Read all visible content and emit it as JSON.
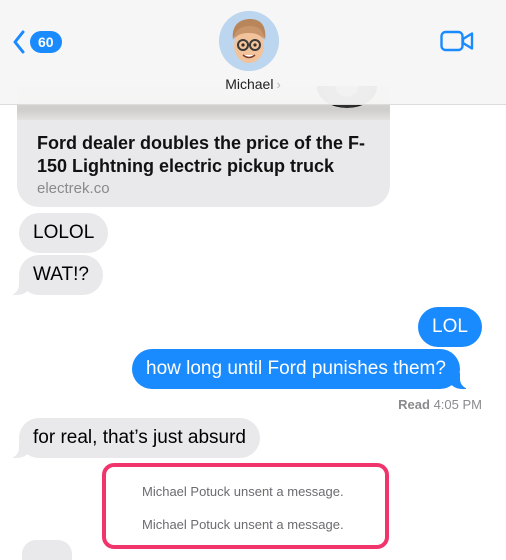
{
  "header": {
    "back_badge": "60",
    "contact_name": "Michael",
    "contact_chevron": "›",
    "icons": {
      "back": "chevron-left-icon",
      "avatar": "memoji-avatar",
      "video": "facetime-video-icon"
    }
  },
  "link_preview": {
    "title": "Ford dealer doubles the price of the F-150 Lightning electric pickup truck",
    "domain": "electrek.co"
  },
  "messages": {
    "lolol": "LOLOL",
    "wat": "WAT!?",
    "lol": "LOL",
    "how_long": "how long until Ford punishes them?",
    "for_real": "for real, that’s just absurd"
  },
  "receipt": {
    "status": "Read",
    "time": "4:05 PM"
  },
  "unsent_notices": [
    "Michael Potuck unsent a message.",
    "Michael Potuck unsent a message."
  ],
  "colors": {
    "accent": "#1a8aff",
    "incoming_bubble": "#e9e9eb",
    "highlight_border": "#f1346c"
  }
}
